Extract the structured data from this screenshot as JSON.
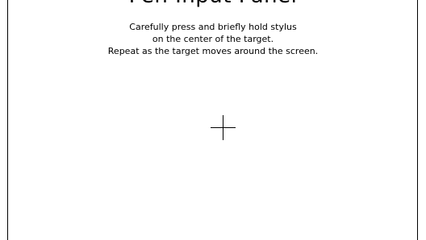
{
  "header": {
    "partial_text": "Pen Input Panel"
  },
  "instructions": {
    "line1": "Carefully press and briefly hold stylus",
    "line2": "on the center of the target.",
    "line3": "Repeat as the target moves around the screen."
  },
  "target": {
    "icon": "crosshair-target-icon"
  },
  "colors": {
    "background": "#ffffff",
    "foreground": "#000000"
  }
}
